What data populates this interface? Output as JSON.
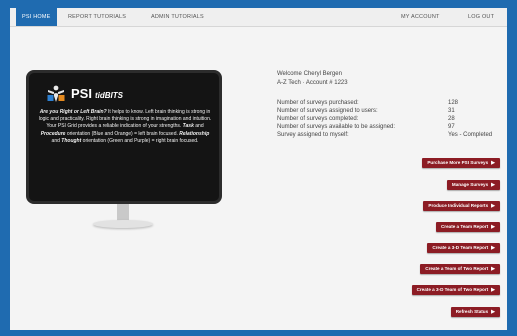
{
  "nav": {
    "items": [
      {
        "label": "PSI HOME",
        "active": true
      },
      {
        "label": "REPORT TUTORIALS",
        "active": false
      },
      {
        "label": "ADMIN TUTORIALS",
        "active": false
      },
      {
        "label": "MY ACCOUNT",
        "active": false
      },
      {
        "label": "LOG OUT",
        "active": false
      }
    ]
  },
  "promo": {
    "logo_icon": "psi-person-icon",
    "title": "PSI",
    "subtitle": "tidBITS",
    "lead": "Are you Right or Left Brain?",
    "body1": " It helps to know. Left brain thinking is strong in logic and practicality. Right brain thinking is strong in imagination and intuition. Your PSI Grid provides a reliable indication of your strengths. ",
    "task": "Task",
    "and": " and ",
    "procedure": "Procedure",
    "body2": " orientation (Blue and Orange) = left brain focused. ",
    "relationship": "Relationship",
    "and2": " and ",
    "thought": "Thought",
    "body3": " orientation (Green and Purple) = right brain focused."
  },
  "account": {
    "welcome": "Welcome Cheryl Bergen",
    "company": "A-Z Tech · Account # 1223"
  },
  "stats": [
    {
      "label": "Number of surveys purchased:",
      "value": "128"
    },
    {
      "label": "Number of surveys assigned to users:",
      "value": "31"
    },
    {
      "label": "Number of surveys completed:",
      "value": "28"
    },
    {
      "label": "Number of surveys available to be assigned:",
      "value": "97"
    },
    {
      "label": "Survey assigned to myself:",
      "value": "Yes - Completed"
    }
  ],
  "actions": [
    "Purchase More PSI Surveys",
    "Manage Surveys",
    "Produce Individual Reports",
    "Create a Team Report",
    "Create a 3-D Team Report",
    "Create a Team of Two Report",
    "Create a 3-D Team of Two Report",
    "Refresh Status"
  ],
  "colors": {
    "background": "#1f6bb0",
    "accent": "#1f6bb0",
    "button": "#8c1c24"
  }
}
